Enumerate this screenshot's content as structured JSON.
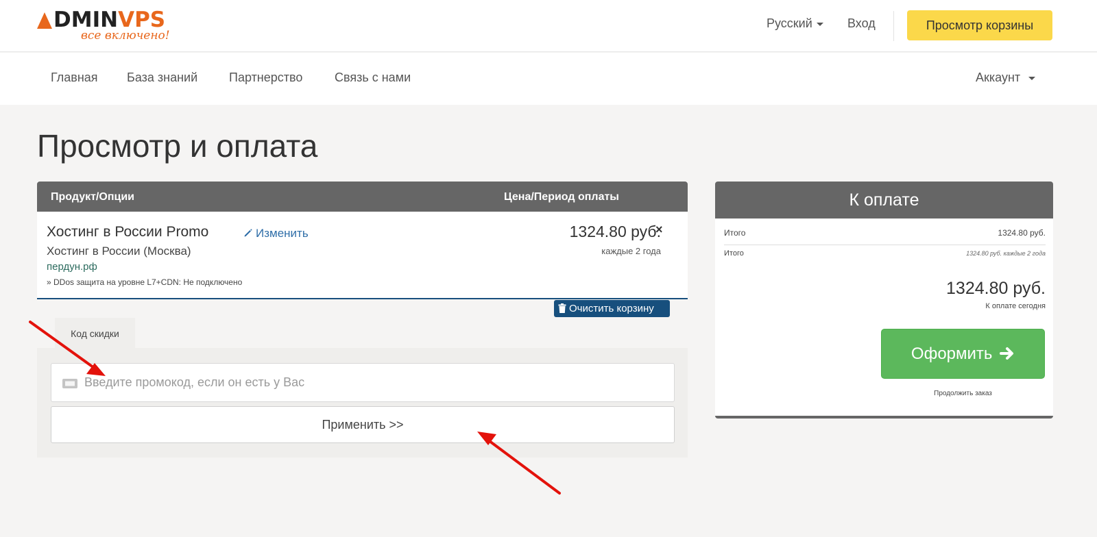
{
  "brand": {
    "logo_prefix": "ADMIN",
    "logo_suffix": "PS",
    "tagline": "все включено!"
  },
  "header": {
    "language": "Русский",
    "login": "Вход",
    "view_cart": "Просмотр корзины"
  },
  "nav": {
    "items": [
      "Главная",
      "База знаний",
      "Партнерство",
      "Связь с нами"
    ],
    "account": "Аккаунт"
  },
  "page": {
    "title": "Просмотр и оплата"
  },
  "cart": {
    "col_product": "Продукт/Опции",
    "col_price": "Цена/Период оплаты",
    "item": {
      "name": "Хостинг в России Promo",
      "edit": "Изменить",
      "group": "Хостинг в России (Москва)",
      "domain": "пердун.рф",
      "option": "» DDos защита на уровне L7+CDN: Не подключено",
      "price": "1324.80 руб.",
      "period": "каждые 2 года",
      "remove": "×"
    },
    "clear_button": "Очистить корзину"
  },
  "promo": {
    "tab_label": "Код скидки",
    "placeholder": "Введите промокод, если он есть у Вас",
    "value": "",
    "apply_button": "Применить >>"
  },
  "summary": {
    "title": "К оплате",
    "subtotal_label": "Итого",
    "subtotal_value": "1324.80 руб.",
    "recurring_label": "Итого",
    "recurring_value": "1324.80 руб. каждые 2 года",
    "total_value": "1324.80 руб.",
    "total_label": "К оплате сегодня",
    "checkout_button": "Оформить",
    "continue_link": "Продолжить заказ"
  },
  "colors": {
    "accent_orange": "#e8671c",
    "cart_button_yellow": "#fbd84a",
    "header_gray": "#666666",
    "checkout_green": "#5cb85c",
    "clear_button_blue": "#174f7d",
    "annotation_red": "#e3120b"
  }
}
